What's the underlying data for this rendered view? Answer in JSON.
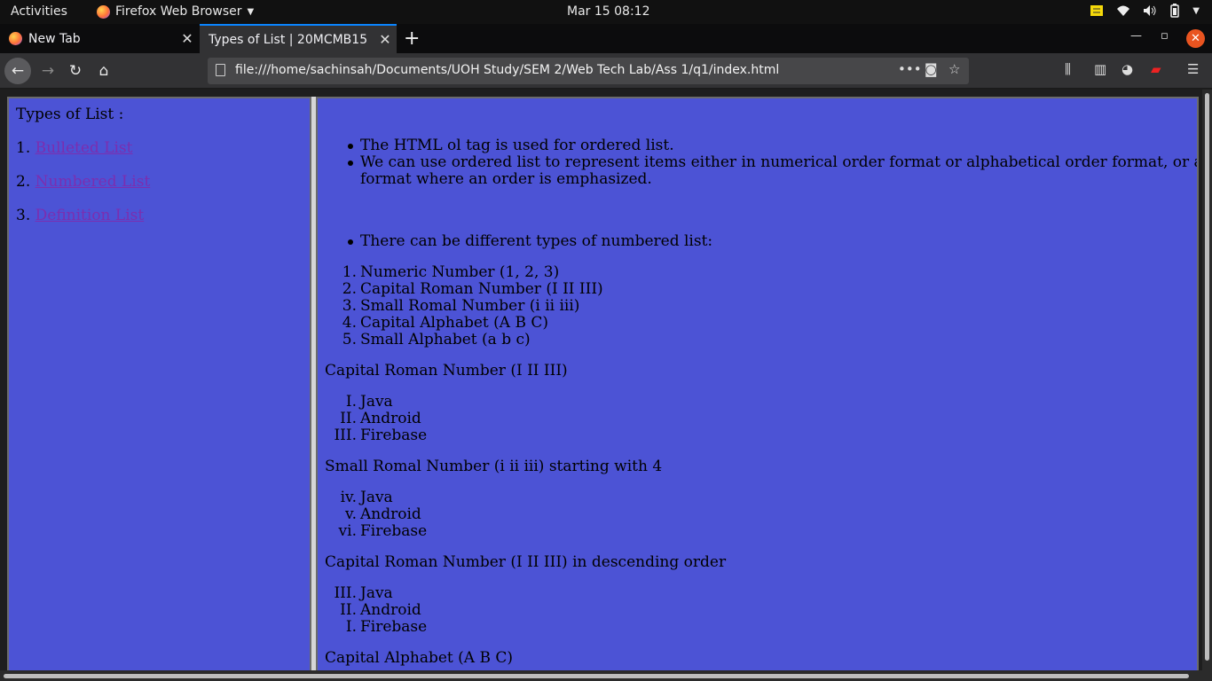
{
  "system": {
    "activities": "Activities",
    "app_name": "Firefox Web Browser",
    "clock": "Mar 15  08:12"
  },
  "tabs": [
    {
      "label": "New Tab"
    },
    {
      "label": "Types of List | 20MCMB15"
    }
  ],
  "address_bar": {
    "url": "file:///home/sachinsah/Documents/UOH Study/SEM 2/Web Tech Lab/Ass 1/q1/index.html"
  },
  "sidebar": {
    "heading": "Types of List :",
    "items": [
      {
        "number": "1.",
        "label": "Bulleted List"
      },
      {
        "number": "2.",
        "label": "Numbered List"
      },
      {
        "number": "3.",
        "label": "Definition List"
      }
    ]
  },
  "main": {
    "intro_bullets": [
      "The HTML ol tag is used for ordered list.",
      "We can use ordered list to represent items either in numerical order format or alphabetical order format, or any",
      "format where an order is emphasized."
    ],
    "types_bullet": "There can be different types of numbered list:",
    "types": [
      {
        "marker": "1.",
        "text": "Numeric Number (1, 2, 3)"
      },
      {
        "marker": "2.",
        "text": "Capital Roman Number (I II III)"
      },
      {
        "marker": "3.",
        "text": "Small Romal Number (i ii iii)"
      },
      {
        "marker": "4.",
        "text": "Capital Alphabet (A B C)"
      },
      {
        "marker": "5.",
        "text": "Small Alphabet (a b c)"
      }
    ],
    "sections": [
      {
        "title": "Capital Roman Number (I II III)",
        "items": [
          {
            "marker": "I.",
            "text": "Java"
          },
          {
            "marker": "II.",
            "text": "Android"
          },
          {
            "marker": "III.",
            "text": "Firebase"
          }
        ]
      },
      {
        "title": "Small Romal Number (i ii iii) starting with 4",
        "items": [
          {
            "marker": "iv.",
            "text": "Java"
          },
          {
            "marker": "v.",
            "text": "Android"
          },
          {
            "marker": "vi.",
            "text": "Firebase"
          }
        ]
      },
      {
        "title": "Capital Roman Number (I II III) in descending order",
        "items": [
          {
            "marker": "III.",
            "text": "Java"
          },
          {
            "marker": "II.",
            "text": "Android"
          },
          {
            "marker": "I.",
            "text": "Firebase"
          }
        ]
      },
      {
        "title": "Capital Alphabet (A B C)",
        "items": []
      }
    ]
  },
  "colors": {
    "frame_background": "#4c53d5",
    "link_visited": "#7b2eb0",
    "tab_accent": "#0a84ff",
    "close_button": "#e95420"
  }
}
